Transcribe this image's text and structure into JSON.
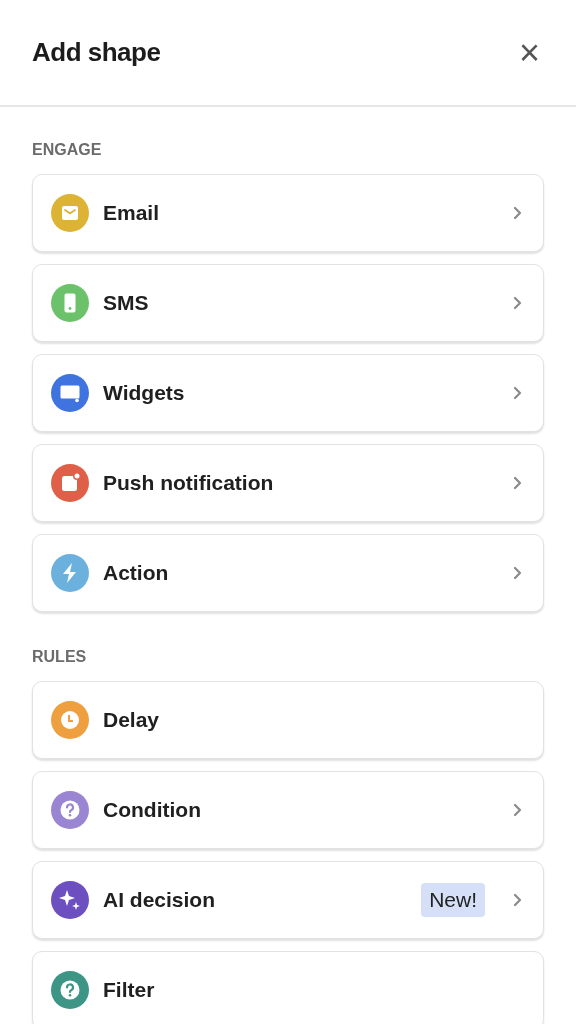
{
  "header": {
    "title": "Add shape",
    "close": "×"
  },
  "sections": [
    {
      "label": "ENGAGE",
      "items": [
        {
          "kind": "email",
          "label": "Email",
          "color": "#ddb335",
          "chevron": true
        },
        {
          "kind": "sms",
          "label": "SMS",
          "color": "#6cc26b",
          "chevron": true
        },
        {
          "kind": "widget",
          "label": "Widgets",
          "color": "#3f74e0",
          "chevron": true
        },
        {
          "kind": "push",
          "label": "Push notification",
          "color": "#e05f48",
          "chevron": true
        },
        {
          "kind": "action",
          "label": "Action",
          "color": "#6cb1de",
          "chevron": true
        }
      ]
    },
    {
      "label": "RULES",
      "items": [
        {
          "kind": "delay",
          "label": "Delay",
          "color": "#ee9f40",
          "chevron": false
        },
        {
          "kind": "condition",
          "label": "Condition",
          "color": "#9a85d3",
          "chevron": true
        },
        {
          "kind": "ai",
          "label": "AI decision",
          "color": "#6d4fbf",
          "chevron": true,
          "badge": "New!"
        },
        {
          "kind": "filter",
          "label": "Filter",
          "color": "#3c9585",
          "chevron": false
        }
      ]
    }
  ]
}
